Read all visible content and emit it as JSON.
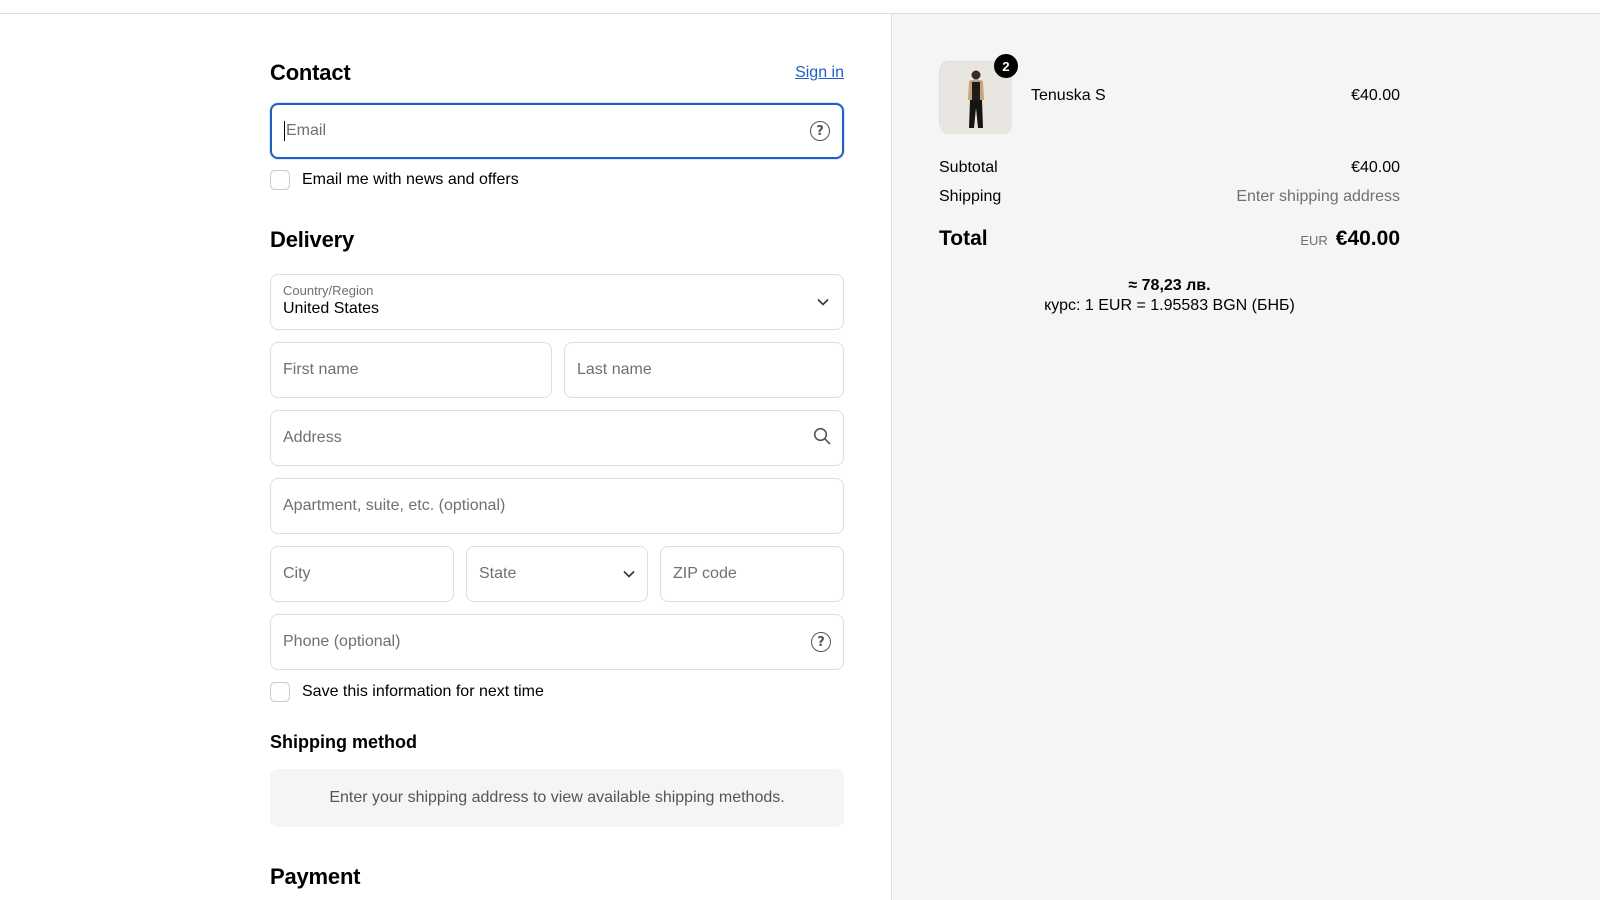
{
  "contact": {
    "title": "Contact",
    "sign_in": "Sign in",
    "email_placeholder": "Email",
    "newsletter_label": "Email me with news and offers"
  },
  "delivery": {
    "title": "Delivery",
    "country_label": "Country/Region",
    "country_value": "United States",
    "first_name_placeholder": "First name",
    "last_name_placeholder": "Last name",
    "address_placeholder": "Address",
    "apartment_placeholder": "Apartment, suite, etc. (optional)",
    "city_placeholder": "City",
    "state_placeholder": "State",
    "zip_placeholder": "ZIP code",
    "phone_placeholder": "Phone (optional)",
    "save_info_label": "Save this information for next time"
  },
  "shipping_method": {
    "title": "Shipping method",
    "notice": "Enter your shipping address to view available shipping methods."
  },
  "payment": {
    "title": "Payment"
  },
  "order": {
    "item": {
      "name": "Tenuska S",
      "quantity": "2",
      "price": "€40.00"
    },
    "subtotal_label": "Subtotal",
    "subtotal_value": "€40.00",
    "shipping_label": "Shipping",
    "shipping_value": "Enter shipping address",
    "total_label": "Total",
    "total_currency": "EUR",
    "total_value": "€40.00",
    "approx": "≈ 78,23 лв.",
    "rate": "курс: 1 EUR = 1.95583 BGN (БНБ)"
  },
  "colors": {
    "accent": "#1f5fc1",
    "summary_bg": "#f5f5f5",
    "border": "#dedede"
  },
  "icons": [
    "help-circle-icon",
    "chevron-down-icon",
    "search-icon"
  ]
}
